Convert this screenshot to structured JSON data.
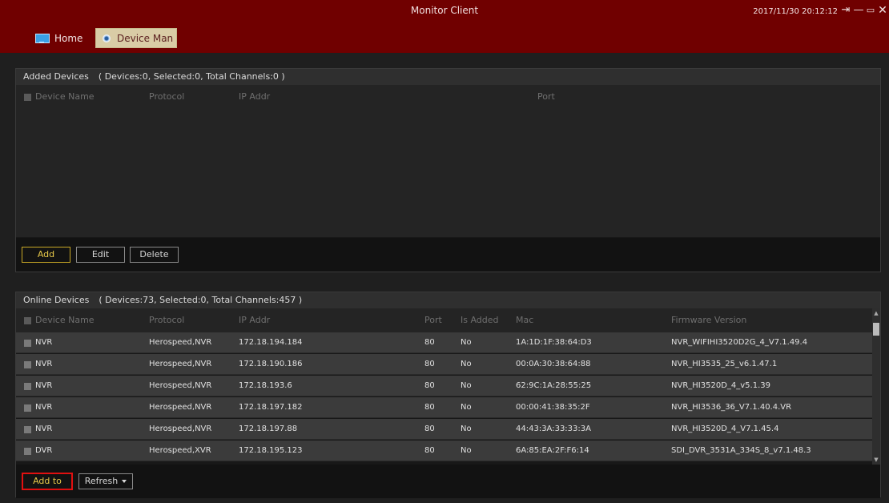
{
  "window": {
    "title": "Monitor Client",
    "datetime": "2017/11/30 20:12:12",
    "controls": {
      "logout": "⇥",
      "minimize": "—",
      "restore": "▭",
      "close": "✕"
    }
  },
  "nav": {
    "home": "Home",
    "device_man": "Device Man",
    "active": "Device Man"
  },
  "added_devices": {
    "title": "Added Devices",
    "summary": "( Devices:0, Selected:0, Total Channels:0 )",
    "columns": [
      "Device Name",
      "Protocol",
      "IP Addr",
      "Port"
    ],
    "rows": [],
    "buttons": {
      "add": "Add",
      "edit": "Edit",
      "delete": "Delete"
    }
  },
  "online_devices": {
    "title": "Online Devices",
    "summary": "( Devices:73, Selected:0, Total Channels:457 )",
    "columns": [
      "Device Name",
      "Protocol",
      "IP Addr",
      "Port",
      "Is Added",
      "Mac",
      "Firmware Version"
    ],
    "rows": [
      {
        "name": "NVR",
        "protocol": "Herospeed,NVR",
        "ip": "172.18.194.184",
        "port": "80",
        "added": "No",
        "mac": "1A:1D:1F:38:64:D3",
        "firmware": "NVR_WIFIHI3520D2G_4_V7.1.49.4"
      },
      {
        "name": "NVR",
        "protocol": "Herospeed,NVR",
        "ip": "172.18.190.186",
        "port": "80",
        "added": "No",
        "mac": "00:0A:30:38:64:88",
        "firmware": "NVR_HI3535_25_v6.1.47.1"
      },
      {
        "name": "NVR",
        "protocol": "Herospeed,NVR",
        "ip": "172.18.193.6",
        "port": "80",
        "added": "No",
        "mac": "62:9C:1A:28:55:25",
        "firmware": "NVR_HI3520D_4_v5.1.39"
      },
      {
        "name": "NVR",
        "protocol": "Herospeed,NVR",
        "ip": "172.18.197.182",
        "port": "80",
        "added": "No",
        "mac": "00:00:41:38:35:2F",
        "firmware": "NVR_HI3536_36_V7.1.40.4.VR"
      },
      {
        "name": "NVR",
        "protocol": "Herospeed,NVR",
        "ip": "172.18.197.88",
        "port": "80",
        "added": "No",
        "mac": "44:43:3A:33:33:3A",
        "firmware": "NVR_HI3520D_4_V7.1.45.4"
      },
      {
        "name": "DVR",
        "protocol": "Herospeed,XVR",
        "ip": "172.18.195.123",
        "port": "80",
        "added": "No",
        "mac": "6A:85:EA:2F:F6:14",
        "firmware": "SDI_DVR_3531A_334S_8_v7.1.48.3"
      }
    ],
    "buttons": {
      "add_to": "Add to",
      "refresh": "Refresh"
    }
  },
  "colors": {
    "titlebar": "#700000",
    "active_tab": "#d9cca6",
    "accent_yellow": "#e6c84a",
    "highlight_red": "#e01010"
  }
}
